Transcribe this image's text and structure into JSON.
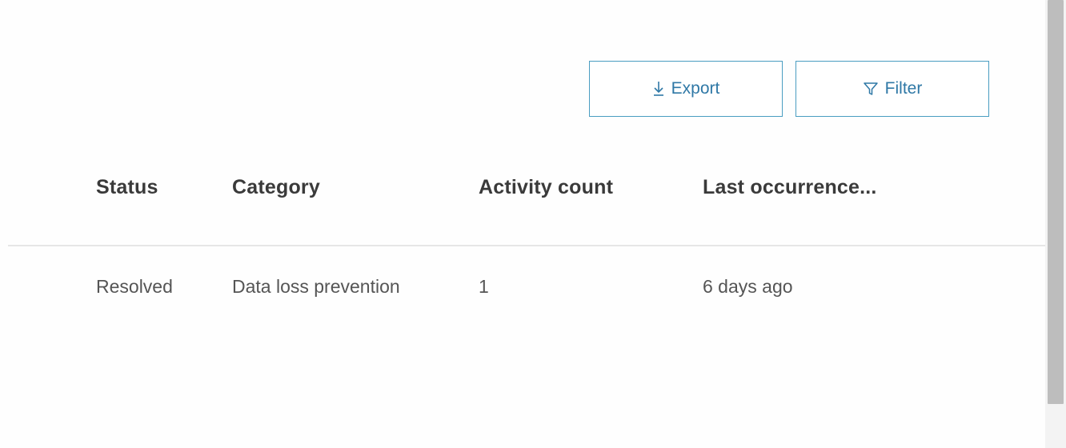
{
  "toolbar": {
    "export_label": "Export",
    "export_icon": "download-icon",
    "filter_label": "Filter",
    "filter_icon": "filter-icon",
    "accent_color": "#2f78a6",
    "border_color": "#4a9dc1"
  },
  "table": {
    "columns": [
      "Status",
      "Category",
      "Activity count",
      "Last occurrence..."
    ],
    "rows": [
      [
        "Resolved",
        "Data loss prevention",
        "1",
        "6 days ago"
      ]
    ]
  }
}
